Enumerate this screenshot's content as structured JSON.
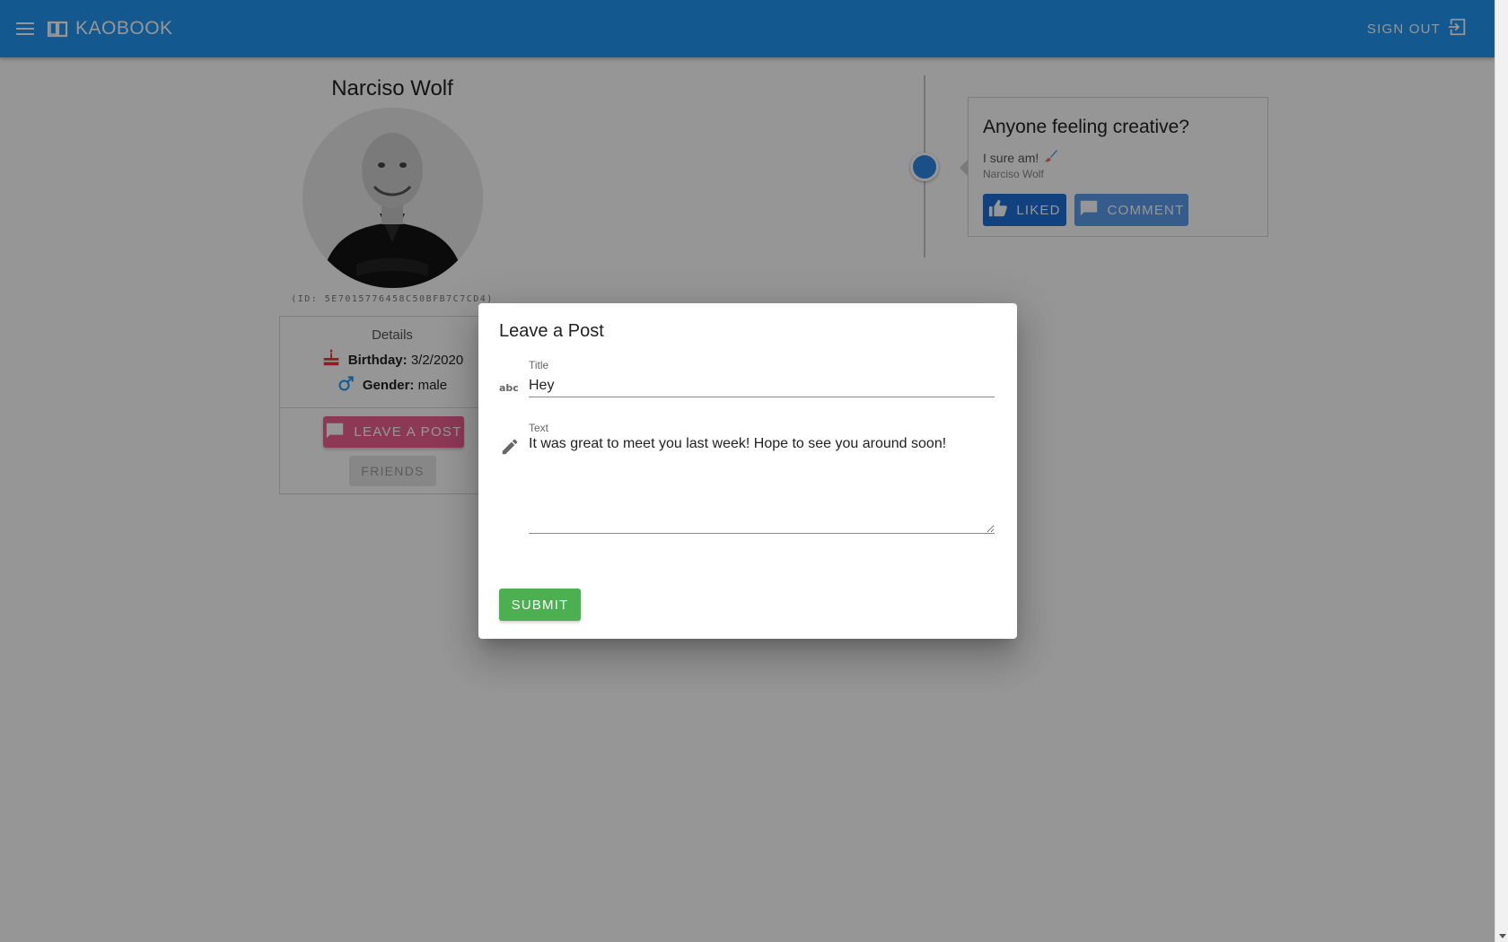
{
  "app": {
    "brand": "KAOBOOK",
    "sign_out_label": "SIGN OUT"
  },
  "colors": {
    "appbar": "#2196f3",
    "leave_post_button": "#f06292",
    "liked_button": "#1e6fd9",
    "comment_button": "#5c9dee",
    "submit_button": "#4caf50"
  },
  "profile": {
    "name": "Narciso Wolf",
    "id_text": "(ID: 5E7015776458C50BFB7C7CD4)",
    "details_title": "Details",
    "birthday_label": "Birthday:",
    "birthday_value": "3/2/2020",
    "gender_label": "Gender:",
    "gender_value": "male",
    "leave_post_label": "LEAVE A POST",
    "friends_label": "FRIENDS"
  },
  "post": {
    "title": "Anyone feeling creative?",
    "text": "I sure am!",
    "author": "Narciso Wolf",
    "liked_label": "LIKED",
    "comment_label": "COMMENT"
  },
  "dialog": {
    "title": "Leave a Post",
    "title_field_label": "Title",
    "title_field_value": "Hey",
    "text_field_label": "Text",
    "text_field_value": "It was great to meet you last week! Hope to see you around soon!",
    "submit_label": "SUBMIT"
  },
  "icons": {
    "menu": "menu-icon",
    "logo": "book-icon",
    "sign_out": "exit-icon",
    "birthday": "cake-icon",
    "gender": "male-icon",
    "leave_post": "chat-bubble-icon",
    "like": "thumb-up-icon",
    "comment": "comment-icon",
    "brush": "paintbrush-icon",
    "title_field": "abc-icon",
    "text_field": "pencil-icon"
  }
}
